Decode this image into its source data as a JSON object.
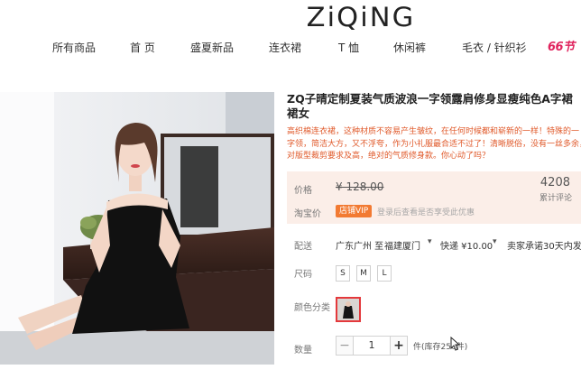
{
  "brand": {
    "logo_text": "ZiQiNG"
  },
  "nav": {
    "items": [
      "所有商品",
      "首 页",
      "盛夏新品",
      "连衣裙",
      "T 恤",
      "休闲裤",
      "毛衣 / 针织衫"
    ],
    "badge": "66节"
  },
  "product": {
    "title_line1": "ZQ子晴定制夏装气质波浪一字领露肩修身显瘦纯色A字裙",
    "title_line2": "裙女",
    "description": [
      "高织棉连衣裙，这种材质不容易产生皱纹，在任何时候都和崭新的一样！特殊的一",
      "字领，简洁大方，又不浮夸，作为小礼服最合适不过了！清晰脱俗，没有一丝多余，",
      "对版型裁剪要求及高，绝对的气质修身款。你心动了吗？"
    ]
  },
  "price": {
    "label": "价格",
    "value": "¥ 128.00",
    "review_count": "4208",
    "review_label": "累计评论",
    "taobao_label": "淘宝价",
    "vip_badge": "店铺VIP",
    "vip_note": "登录后查看是否享受此优惠"
  },
  "shipping": {
    "label": "配送",
    "from": "广东广州 至",
    "to": "福建厦门",
    "fee": "快递 ¥10.00",
    "promise": "卖家承诺30天内发"
  },
  "size": {
    "label": "尺码",
    "options": [
      "S",
      "M",
      "L"
    ]
  },
  "color": {
    "label": "颜色分类"
  },
  "quantity": {
    "label": "数量",
    "value": "1",
    "minus": "−",
    "plus": "+",
    "stock": "件(库存256件)"
  },
  "colors": {
    "accent": "#e4393c",
    "vip": "#f27a32",
    "price_bg": "#fbeee8",
    "desc": "#e05a2b"
  }
}
